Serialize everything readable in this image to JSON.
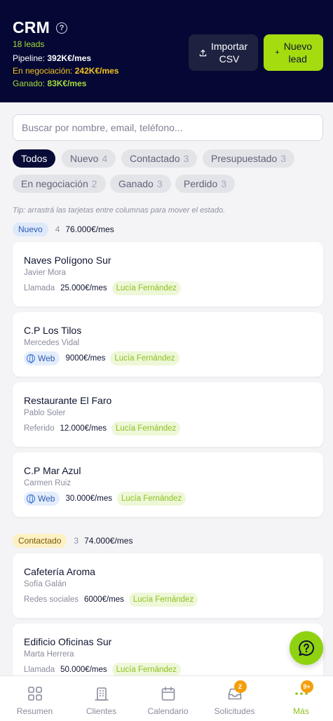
{
  "header": {
    "title": "CRM",
    "leads_count": "18 leads",
    "pipeline_label": "Pipeline:",
    "pipeline_value": "392K€/mes",
    "negoc_label": "En negociación:",
    "negoc_value": "242K€/mes",
    "ganado_label": "Ganado:",
    "ganado_value": "83K€/mes",
    "import_label": "Importar CSV",
    "new_label": "Nuevo lead",
    "colors": {
      "background": "#050834",
      "accent": "#a4dc10",
      "negociacion": "#f4c21e"
    }
  },
  "search": {
    "placeholder": "Buscar por nombre, email, teléfono..."
  },
  "filters": [
    {
      "label": "Todos",
      "count": ""
    },
    {
      "label": "Nuevo",
      "count": "4"
    },
    {
      "label": "Contactado",
      "count": "3"
    },
    {
      "label": "Presupuestado",
      "count": "3"
    },
    {
      "label": "En negociación",
      "count": "2"
    },
    {
      "label": "Ganado",
      "count": "3"
    },
    {
      "label": "Perdido",
      "count": "3"
    }
  ],
  "tip": "Tip: arrastrá las tarjetas entre columnas para mover el estado.",
  "columns": [
    {
      "name": "Nuevo",
      "count": "4",
      "total": "76.000€/mes",
      "cards": [
        {
          "name": "Naves Polígono Sur",
          "contact": "Javier Mora",
          "source": "Llamada",
          "amount": "25.000€/mes",
          "owner": "Lucía Fernández"
        },
        {
          "name": "C.P Los Tilos",
          "contact": "Mercedes Vidal",
          "source": "Web",
          "amount": "9000€/mes",
          "owner": "Lucía Fernández"
        },
        {
          "name": "Restaurante El Faro",
          "contact": "Pablo Soler",
          "source": "Referido",
          "amount": "12.000€/mes",
          "owner": "Lucía Fernández"
        },
        {
          "name": "C.P Mar Azul",
          "contact": "Carmen Ruiz",
          "source": "Web",
          "amount": "30.000€/mes",
          "owner": "Lucía Fernández"
        }
      ]
    },
    {
      "name": "Contactado",
      "count": "3",
      "total": "74.000€/mes",
      "cards": [
        {
          "name": "Cafetería Aroma",
          "contact": "Sofía Galán",
          "source": "Redes sociales",
          "amount": "6000€/mes",
          "owner": "Lucía Fernández"
        },
        {
          "name": "Edificio Oficinas Sur",
          "contact": "Marta Herrera",
          "source": "Llamada",
          "amount": "50.000€/mes",
          "owner": "Lucía Fernández"
        }
      ]
    }
  ],
  "nav": [
    {
      "label": "Resumen",
      "icon": "grid-icon"
    },
    {
      "label": "Clientes",
      "icon": "building-icon"
    },
    {
      "label": "Calendario",
      "icon": "calendar-icon"
    },
    {
      "label": "Solicitudes",
      "icon": "inbox-icon",
      "badge": "2"
    },
    {
      "label": "Más",
      "icon": "dots-icon",
      "badge": "9+"
    }
  ],
  "fab": {
    "icon": "chat-help-icon"
  }
}
